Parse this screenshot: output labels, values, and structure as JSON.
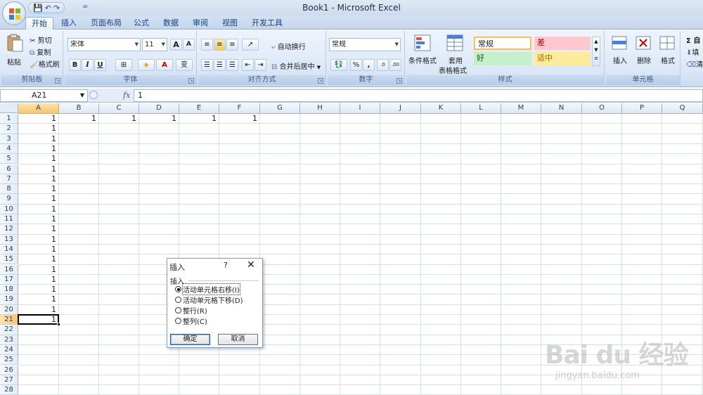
{
  "window": {
    "title": "Book1 - Microsoft Excel"
  },
  "qat": {
    "save": "💾",
    "undo": "↶",
    "redo": "↷",
    "more": "="
  },
  "tabs": [
    "开始",
    "插入",
    "页面布局",
    "公式",
    "数据",
    "审阅",
    "视图",
    "开发工具"
  ],
  "ribbon": {
    "clipboard": {
      "label": "剪贴板",
      "paste": "粘贴",
      "cut": "剪切",
      "copy": "复制",
      "format_painter": "格式刷"
    },
    "font": {
      "label": "字体",
      "font_name": "宋体",
      "font_size": "11",
      "grow": "A",
      "shrink": "A",
      "bold": "B",
      "italic": "I",
      "underline": "U",
      "wen": "变"
    },
    "alignment": {
      "label": "对齐方式",
      "wrap_text": "自动换行",
      "merge_center": "合并后居中"
    },
    "number": {
      "label": "数字",
      "format": "常规",
      "percent": "%",
      "comma": ","
    },
    "styles": {
      "label": "样式",
      "cond_format": "条件格式",
      "table_format_1": "套用",
      "table_format_2": "表格格式",
      "normal": "常规",
      "bad": "差",
      "good": "好",
      "neutral": "适中"
    },
    "cells": {
      "label": "单元格",
      "insert": "插入",
      "delete": "删除",
      "format": "格式"
    },
    "editing": {
      "sigma": "Σ 自",
      "fill": "填",
      "clear": "清"
    }
  },
  "formula_bar": {
    "name_box": "A21",
    "fx": "fx",
    "value": "1"
  },
  "columns": [
    "A",
    "B",
    "C",
    "D",
    "E",
    "F",
    "G",
    "H",
    "I",
    "J",
    "K",
    "L",
    "M",
    "N",
    "O",
    "P",
    "Q"
  ],
  "rows": [
    "1",
    "2",
    "3",
    "4",
    "5",
    "6",
    "7",
    "8",
    "9",
    "10",
    "11",
    "12",
    "13",
    "14",
    "15",
    "16",
    "17",
    "18",
    "19",
    "20",
    "21",
    "22",
    "23",
    "24",
    "25",
    "26",
    "27",
    "28"
  ],
  "cells": {
    "row1": [
      "1",
      "1",
      "1",
      "1",
      "1",
      "1"
    ],
    "colA": [
      "1",
      "1",
      "1",
      "1",
      "1",
      "1",
      "1",
      "1",
      "1",
      "1",
      "1",
      "1",
      "1",
      "1",
      "1",
      "1",
      "1",
      "1",
      "1",
      "1",
      "1"
    ]
  },
  "active_cell": "A21",
  "dialog": {
    "title": "插入",
    "help": "?",
    "close": "✕",
    "group": "插入",
    "options": [
      "活动单元格右移(I)",
      "活动单元格下移(D)",
      "整行(R)",
      "整列(C)"
    ],
    "selected_index": 0,
    "ok": "确定",
    "cancel": "取消"
  },
  "watermark": {
    "logo": "Bai du 经验",
    "url": "jingyan.baidu.com"
  },
  "colors": {
    "accent": "#15428b",
    "selected_header": "#f6c66c",
    "bad_bg": "#ffc7ce",
    "good_bg": "#c6efce",
    "neutral_bg": "#ffeb9c"
  }
}
